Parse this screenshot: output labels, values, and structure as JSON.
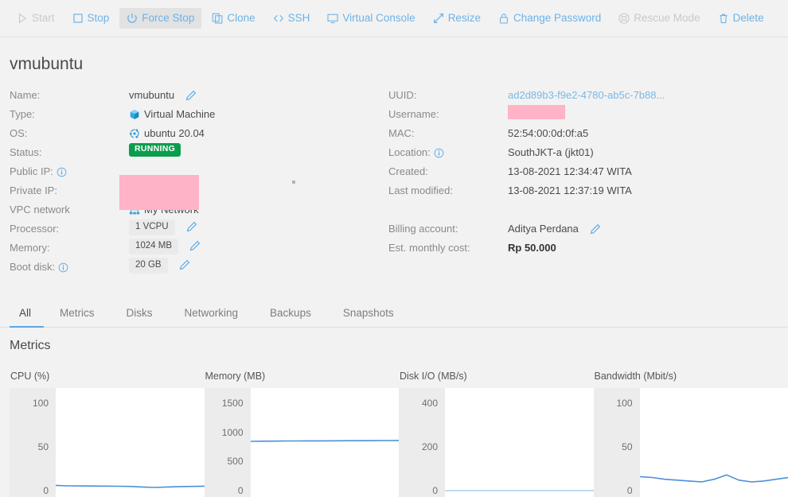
{
  "toolbar": {
    "buttons": [
      {
        "label": "Start",
        "icon": "play-icon",
        "state": "disabled"
      },
      {
        "label": "Stop",
        "icon": "stop-icon",
        "state": "normal"
      },
      {
        "label": "Force Stop",
        "icon": "power-icon",
        "state": "active"
      },
      {
        "label": "Clone",
        "icon": "copy-icon",
        "state": "normal"
      },
      {
        "label": "SSH",
        "icon": "code-icon",
        "state": "normal"
      },
      {
        "label": "Virtual Console",
        "icon": "monitor-icon",
        "state": "normal"
      },
      {
        "label": "Resize",
        "icon": "arrows-icon",
        "state": "normal"
      },
      {
        "label": "Change Password",
        "icon": "lock-icon",
        "state": "normal"
      },
      {
        "label": "Rescue Mode",
        "icon": "lifering-icon",
        "state": "disabled"
      },
      {
        "label": "Delete",
        "icon": "trash-icon",
        "state": "normal"
      }
    ]
  },
  "header": {
    "title": "vmubuntu"
  },
  "details": {
    "left": {
      "name_label": "Name:",
      "name_value": "vmubuntu",
      "type_label": "Type:",
      "type_value": "Virtual Machine",
      "os_label": "OS:",
      "os_value": "ubuntu 20.04",
      "status_label": "Status:",
      "status_value": "RUNNING",
      "public_ip_label": "Public IP:",
      "private_ip_label": "Private IP:",
      "vpc_label": "VPC network",
      "vpc_value": "My Network",
      "processor_label": "Processor:",
      "processor_value": "1 VCPU",
      "memory_label": "Memory:",
      "memory_value": "1024 MB",
      "boot_disk_label": "Boot disk:",
      "boot_disk_value": "20 GB"
    },
    "right": {
      "uuid_label": "UUID:",
      "uuid_value": "ad2d89b3-f9e2-4780-ab5c-7b88...",
      "username_label": "Username:",
      "mac_label": "MAC:",
      "mac_value": "52:54:00:0d:0f:a5",
      "location_label": "Location:",
      "location_value": "SouthJKT-a (jkt01)",
      "created_label": "Created:",
      "created_value": "13-08-2021 12:34:47 WITA",
      "modified_label": "Last modified:",
      "modified_value": "13-08-2021 12:37:19 WITA",
      "billing_label": "Billing account:",
      "billing_value": "Aditya Perdana",
      "cost_label": "Est. monthly cost:",
      "cost_value": "Rp 50.000"
    }
  },
  "tabs": [
    {
      "label": "All",
      "selected": true
    },
    {
      "label": "Metrics",
      "selected": false
    },
    {
      "label": "Disks",
      "selected": false
    },
    {
      "label": "Networking",
      "selected": false
    },
    {
      "label": "Backups",
      "selected": false
    },
    {
      "label": "Snapshots",
      "selected": false
    }
  ],
  "metrics": {
    "title": "Metrics"
  },
  "colors": {
    "accent": "#6cb3e8",
    "status_running": "#0b9d4e",
    "redaction": "#ffb3c6",
    "line": "#4a90d9",
    "line_light": "#a8cdee",
    "page_bg": "#f2f2f2"
  },
  "chart_data": [
    {
      "type": "line",
      "title": "CPU (%)",
      "xlabel": "",
      "ylabel": "",
      "ylim": [
        0,
        110
      ],
      "yticks": [
        0,
        50,
        100
      ],
      "ytick_labels": [
        "0",
        "50",
        "100"
      ],
      "grid": false,
      "line_color": "#4a90d9",
      "x": [
        0,
        1,
        2,
        3,
        4,
        5,
        6,
        7,
        8,
        9,
        10,
        11,
        12
      ],
      "values": [
        6,
        5.5,
        5.4,
        5.3,
        5.2,
        5,
        4.8,
        4.2,
        3.6,
        4.2,
        4.6,
        4.8,
        5.1
      ]
    },
    {
      "type": "line",
      "title": "Memory (MB)",
      "xlabel": "",
      "ylabel": "",
      "ylim": [
        0,
        1650
      ],
      "yticks": [
        0,
        500,
        1000,
        1500
      ],
      "ytick_labels": [
        "0",
        "500",
        "1000",
        "1500"
      ],
      "grid": false,
      "line_color": "#4a90d9",
      "x": [
        0,
        1,
        2,
        3,
        4,
        5,
        6,
        7,
        8,
        9,
        10,
        11,
        12
      ],
      "values": [
        845,
        848,
        850,
        852,
        852,
        853,
        854,
        855,
        856,
        857,
        858,
        859,
        860
      ]
    },
    {
      "type": "line",
      "title": "Disk I/O (MB/s)",
      "xlabel": "",
      "ylabel": "",
      "ylim": [
        0,
        440
      ],
      "yticks": [
        0,
        200,
        400
      ],
      "ytick_labels": [
        "0",
        "200",
        "400"
      ],
      "grid": false,
      "line_color": "#a8cdee",
      "x": [
        0,
        1,
        2,
        3,
        4,
        5,
        6,
        7,
        8,
        9,
        10,
        11,
        12
      ],
      "values": [
        0,
        0,
        0,
        0,
        0,
        0,
        0,
        0,
        0,
        0,
        0,
        0,
        0
      ]
    },
    {
      "type": "line",
      "title": "Bandwidth (Mbit/s)",
      "xlabel": "",
      "ylabel": "",
      "ylim": [
        0,
        110
      ],
      "yticks": [
        0,
        50,
        100
      ],
      "ytick_labels": [
        "0",
        "50",
        "100"
      ],
      "grid": false,
      "line_color": "#4a90d9",
      "x": [
        0,
        1,
        2,
        3,
        4,
        5,
        6,
        7,
        8,
        9,
        10,
        11,
        12
      ],
      "values": [
        16,
        15,
        13,
        12,
        11,
        10,
        13,
        18,
        12,
        10,
        11,
        13,
        15
      ]
    }
  ]
}
